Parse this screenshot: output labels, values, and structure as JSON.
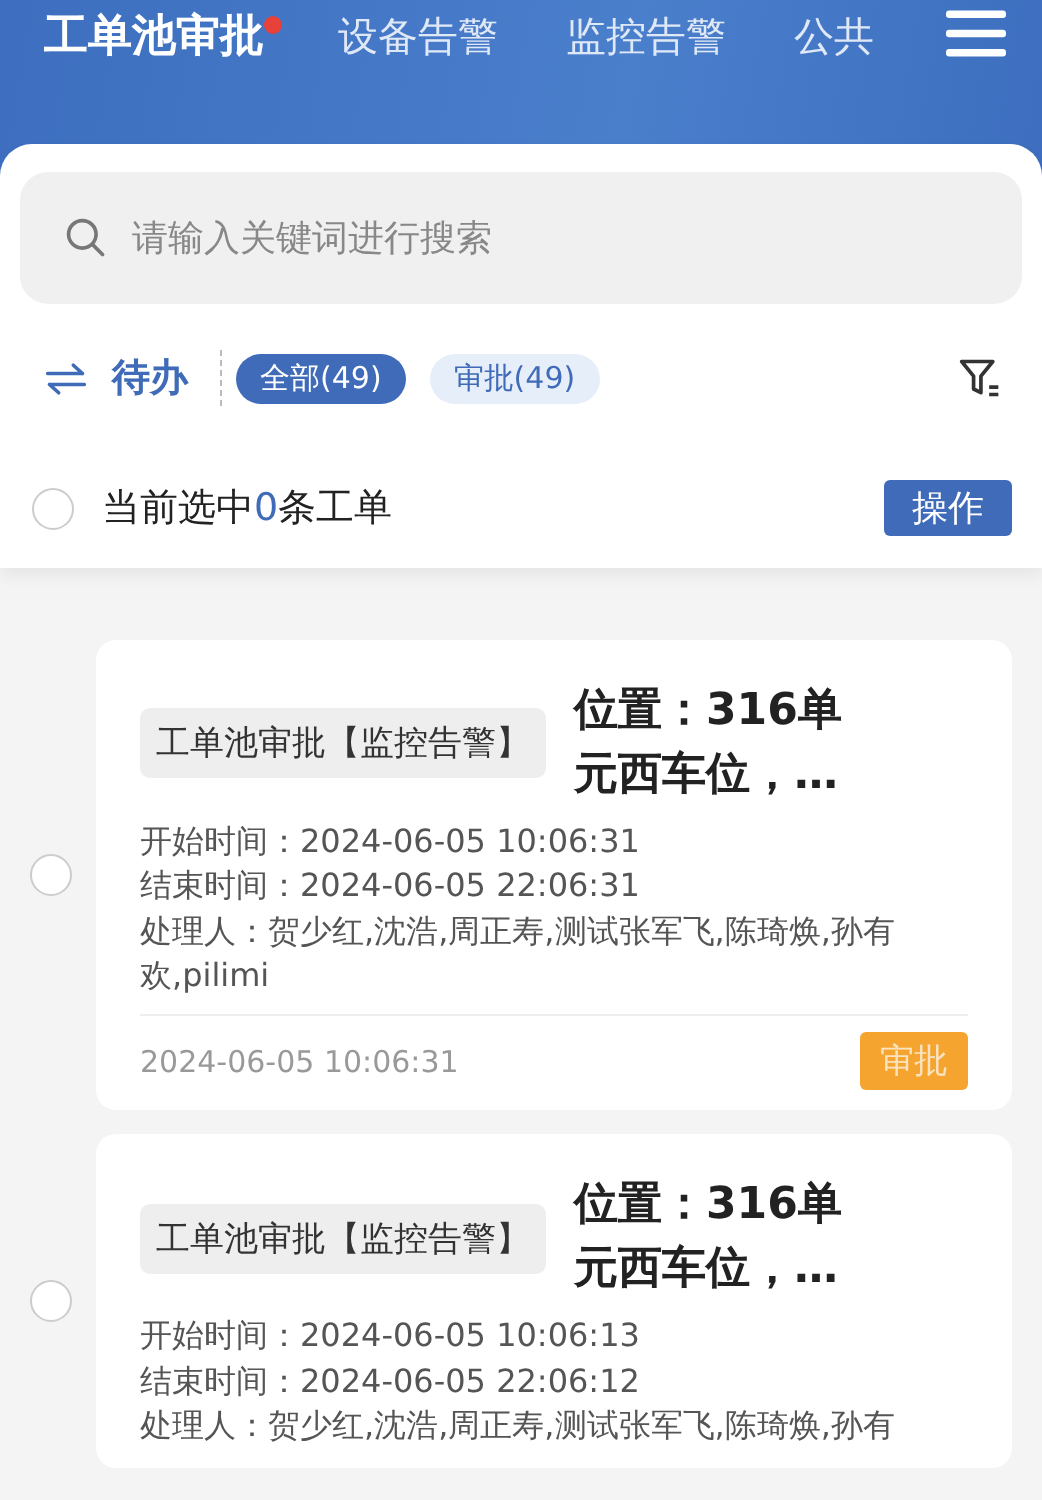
{
  "tabs": [
    {
      "label": "工单池审批",
      "selected": true,
      "unread": true
    },
    {
      "label": "设备告警",
      "selected": false,
      "unread": false
    },
    {
      "label": "监控告警",
      "selected": false,
      "unread": false
    },
    {
      "label": "公共",
      "selected": false,
      "unread": false
    }
  ],
  "search": {
    "placeholder": "请输入关键词进行搜索"
  },
  "filter": {
    "mode": "待办",
    "chips": [
      {
        "label": "全部(49)",
        "selected": true
      },
      {
        "label": "审批(49)",
        "selected": false
      }
    ]
  },
  "selection": {
    "checked": false,
    "prefix": "当前选中",
    "count": "0",
    "suffix": "条工单",
    "action": "操作"
  },
  "orders": [
    {
      "selected": false,
      "tag": "工单池审批【监控告警】",
      "title": "位置：316单元西车位，…",
      "lines": [
        "开始时间：2024-06-05 10:06:31",
        "结束时间：2024-06-05 22:06:31",
        "处理人：贺少红,沈浩,周正寿,测试张军飞,陈琦焕,孙有欢,pilimi"
      ],
      "date": "2024-06-05 10:06:31",
      "action": "审批"
    },
    {
      "selected": false,
      "tag": "工单池审批【监控告警】",
      "title": "位置：316单元西车位，…",
      "lines": [
        "开始时间：2024-06-05 10:06:13",
        "结束时间：2024-06-05 22:06:12",
        "处理人：贺少红,沈浩,周正寿,测试张军飞,陈琦焕,孙有"
      ]
    }
  ]
}
